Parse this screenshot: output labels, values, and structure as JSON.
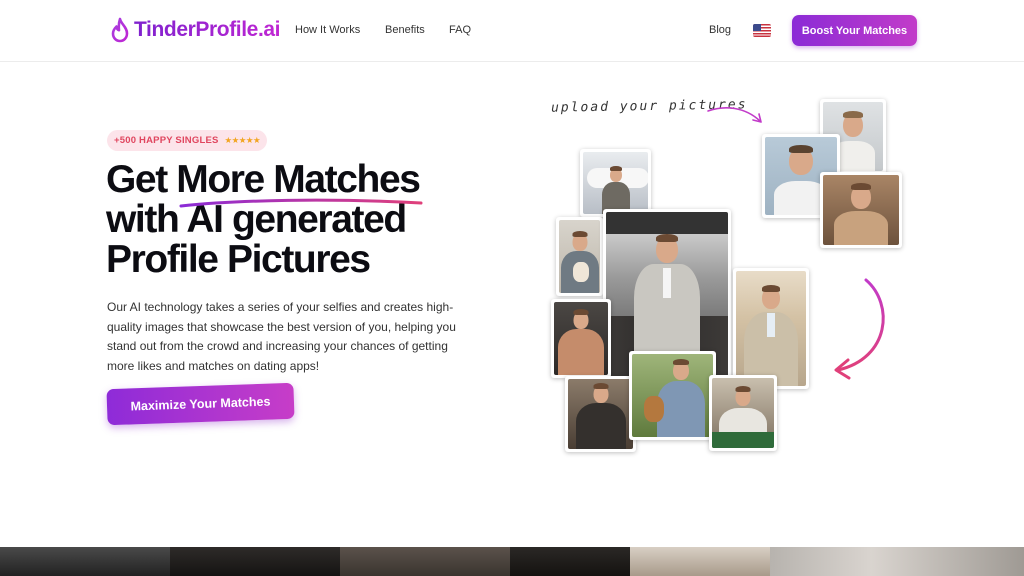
{
  "nav": {
    "brand": "TinderProfile.ai",
    "links": [
      "How It Works",
      "Benefits",
      "FAQ"
    ],
    "blog": "Blog",
    "flag_icon": "us-flag-icon",
    "boost_label": "Boost Your Matches"
  },
  "hero": {
    "badge_text": "+500 HAPPY SINGLES",
    "badge_stars": "★★★★★",
    "headline": [
      "Get More Matches",
      "with AI generated",
      "Profile Pictures"
    ],
    "description": "Our AI technology takes a series of your selfies and creates high-quality images that showcase the best version of you, helping you stand out from the crowd and increasing your chances of getting more likes and matches on dating apps!",
    "cta_label": "Maximize Your Matches"
  },
  "collage": {
    "upload_label": "upload your pictures"
  },
  "colors": {
    "accent_purple": "#8b2bd6",
    "accent_magenta": "#c23bc9",
    "badge_bg": "#fce4ea",
    "badge_text": "#e0465f",
    "star_gold": "#f2a521",
    "arrow_pink": "#e0407a"
  }
}
